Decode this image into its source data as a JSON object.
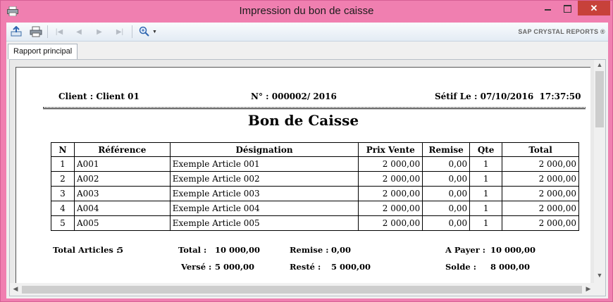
{
  "window": {
    "title": "Impression du bon de caisse",
    "close_glyph": "✕",
    "accent_color": "#f07fb0",
    "close_color": "#c7413a"
  },
  "toolbar": {
    "icons": [
      "export-icon",
      "print-icon",
      "first-page-icon",
      "previous-page-icon",
      "next-page-icon",
      "last-page-icon",
      "zoom-icon",
      "zoom-dropdown-icon"
    ],
    "brand": "SAP CRYSTAL REPORTS ®"
  },
  "tabs": [
    {
      "label": "Rapport principal"
    }
  ],
  "report": {
    "client": "Client : Client 01",
    "numero": "N° : 000002/ 2016",
    "lieu_date": "Sétif Le : 07/10/2016  17:37:50",
    "title": "Bon de Caisse",
    "columns": [
      "N",
      "Référence",
      "Désignation",
      "Prix Vente",
      "Remise",
      "Qte",
      "Total"
    ],
    "rows": [
      [
        "1",
        "A001",
        "Exemple Article 001",
        "2 000,00",
        "0,00",
        "1",
        "2 000,00"
      ],
      [
        "2",
        "A002",
        "Exemple Article 002",
        "2 000,00",
        "0,00",
        "1",
        "2 000,00"
      ],
      [
        "3",
        "A003",
        "Exemple Article 003",
        "2 000,00",
        "0,00",
        "1",
        "2 000,00"
      ],
      [
        "4",
        "A004",
        "Exemple Article 004",
        "2 000,00",
        "0,00",
        "1",
        "2 000,00"
      ],
      [
        "5",
        "A005",
        "Exemple Article 005",
        "2 000,00",
        "0,00",
        "1",
        "2 000,00"
      ]
    ],
    "totals": {
      "total_articles_label": "Total Articles :",
      "total_articles_value": "5",
      "total_label": "Total :",
      "total_value": "10 000,00",
      "remise_label": "Remise :",
      "remise_value": "0,00",
      "a_payer_label": "A Payer :",
      "a_payer_value": "10 000,00",
      "verse_label": "Versé :",
      "verse_value": "5 000,00",
      "reste_label": "Resté :",
      "reste_value": "5 000,00",
      "solde_label": "Solde :",
      "solde_value": "8 000,00"
    }
  }
}
